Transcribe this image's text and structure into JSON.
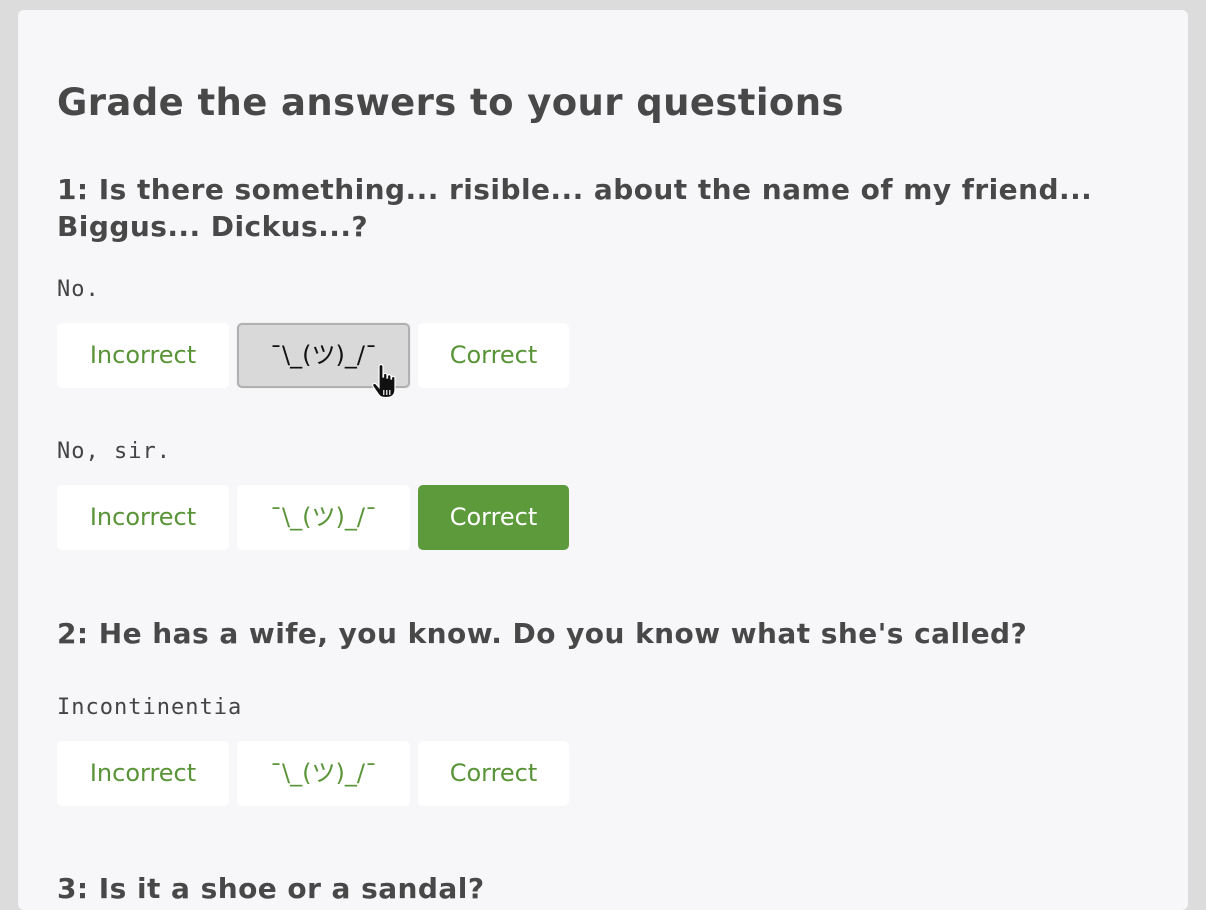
{
  "page": {
    "title": "Grade the answers to your questions"
  },
  "grade_labels": {
    "incorrect": "Incorrect",
    "shrug": "¯\\_(ツ)_/¯",
    "correct": "Correct"
  },
  "questions": [
    {
      "heading": "1: Is there something... risible... about the name of my friend... Biggus... Dickus...?",
      "answers": [
        {
          "text": "No.",
          "state": "hover-shrug"
        },
        {
          "text": "No, sir.",
          "state": "selected-correct"
        }
      ]
    },
    {
      "heading": "2: He has a wife, you know. Do you know what she's called?",
      "answers": [
        {
          "text": "Incontinentia",
          "state": "none"
        }
      ]
    },
    {
      "heading": "3: Is it a shoe or a sandal?",
      "answers": []
    }
  ],
  "colors": {
    "accent_green": "#5c9a3c",
    "text_green": "#5a9438",
    "background": "#f7f7f9"
  },
  "icons": {
    "cursor": "hand-pointer-icon"
  }
}
